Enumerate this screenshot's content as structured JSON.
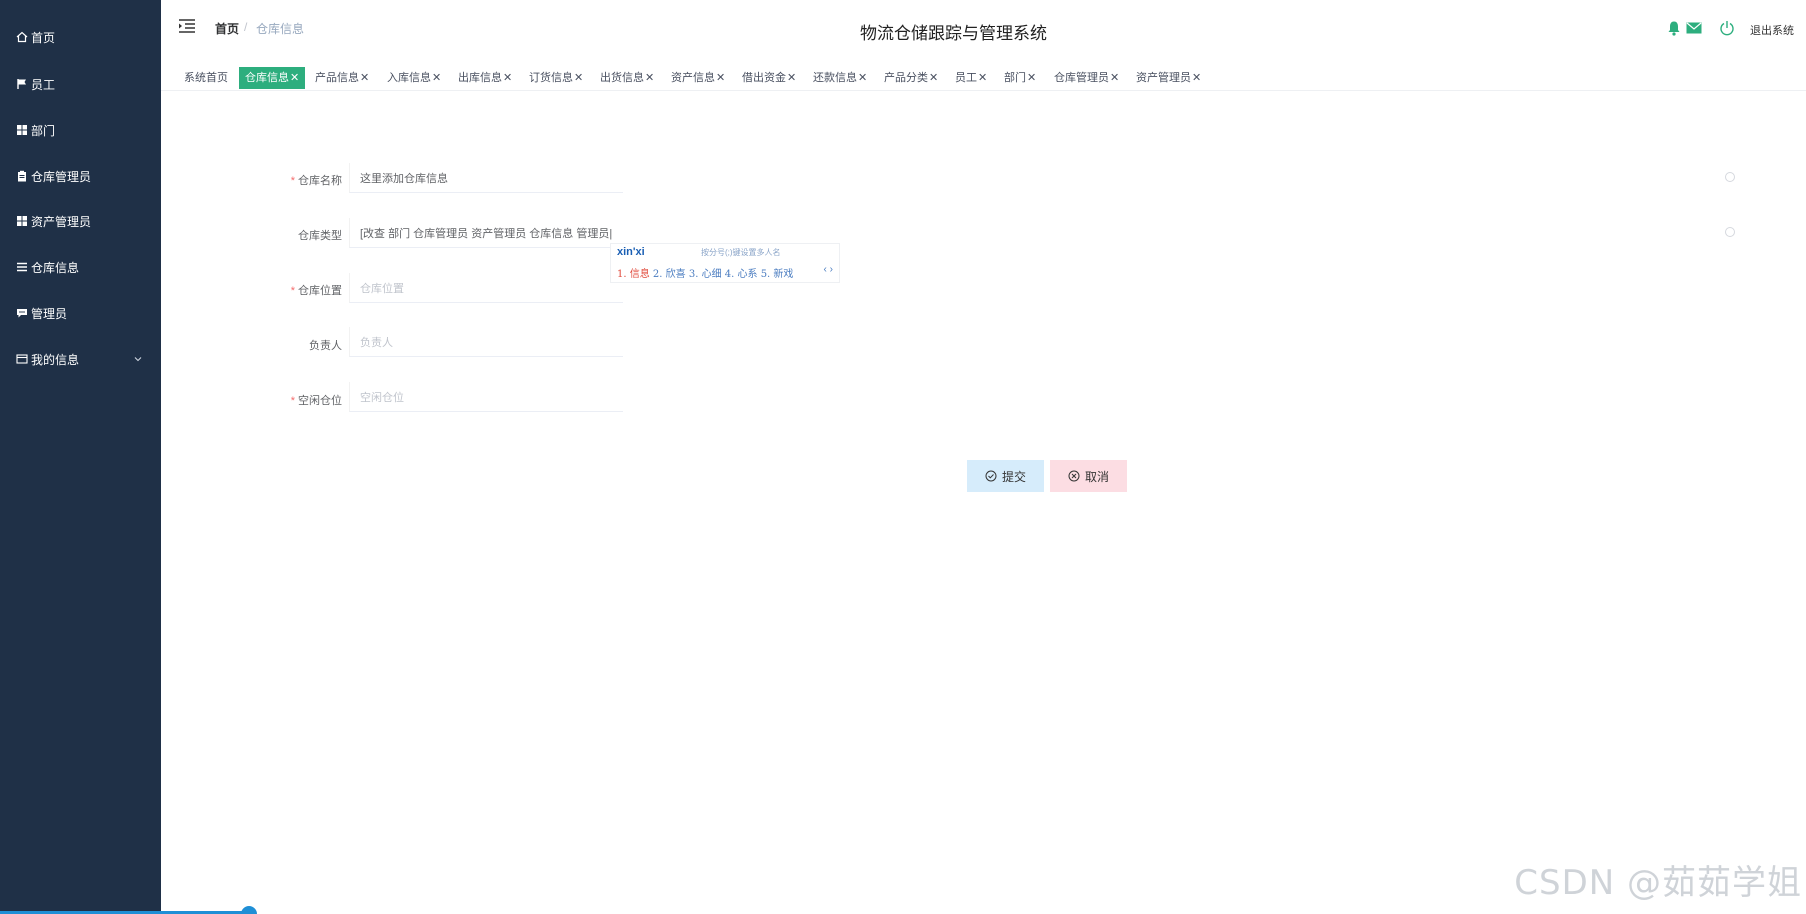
{
  "sidebar": {
    "items": [
      {
        "label": "首页",
        "icon": "home-icon"
      },
      {
        "label": "员工",
        "icon": "flag-icon"
      },
      {
        "label": "部门",
        "icon": "grid-icon"
      },
      {
        "label": "仓库管理员",
        "icon": "clipboard-icon"
      },
      {
        "label": "资产管理员",
        "icon": "grid-icon"
      },
      {
        "label": "仓库信息",
        "icon": "list-icon"
      },
      {
        "label": "管理员",
        "icon": "comment-icon"
      },
      {
        "label": "我的信息",
        "icon": "card-icon"
      }
    ]
  },
  "header": {
    "breadcrumb_home": "首页",
    "breadcrumb_sep": "/",
    "breadcrumb_current": "仓库信息",
    "title": "物流仓储跟踪与管理系统",
    "logout": "退出系统"
  },
  "tags": [
    {
      "label": "系统首页",
      "closable": false
    },
    {
      "label": "仓库信息",
      "closable": true,
      "active": true
    },
    {
      "label": "产品信息",
      "closable": true
    },
    {
      "label": "入库信息",
      "closable": true
    },
    {
      "label": "出库信息",
      "closable": true
    },
    {
      "label": "订货信息",
      "closable": true
    },
    {
      "label": "出货信息",
      "closable": true
    },
    {
      "label": "资产信息",
      "closable": true
    },
    {
      "label": "借出资金",
      "closable": true
    },
    {
      "label": "还款信息",
      "closable": true
    },
    {
      "label": "产品分类",
      "closable": true
    },
    {
      "label": "员工",
      "closable": true
    },
    {
      "label": "部门",
      "closable": true
    },
    {
      "label": "仓库管理员",
      "closable": true
    },
    {
      "label": "资产管理员",
      "closable": true
    }
  ],
  "form": {
    "fields": [
      {
        "label": "仓库名称",
        "required": true,
        "value": "这里添加仓库信息",
        "placeholder": ""
      },
      {
        "label": "仓库类型",
        "required": false,
        "value": "[改查 部门 仓库管理员 资产管理员 仓库信息  管理员|",
        "placeholder": ""
      },
      {
        "label": "仓库位置",
        "required": true,
        "value": "",
        "placeholder": "仓库位置"
      },
      {
        "label": "负责人",
        "required": false,
        "value": "",
        "placeholder": "负责人"
      },
      {
        "label": "空闲仓位",
        "required": true,
        "value": "",
        "placeholder": "空闲仓位"
      }
    ],
    "submit": "提交",
    "cancel": "取消"
  },
  "ime": {
    "pinyin": "xin'xi",
    "hint": "按分号(;)键设置多人名",
    "candidates": [
      "1. 信息",
      "2. 欣喜",
      "3. 心细",
      "4. 心系",
      "5. 新戏"
    ],
    "nav": "‹ ›"
  },
  "watermark": "CSDN @茹茹学姐",
  "colors": {
    "sidebar": "#1f3047",
    "accent": "#2dae7e",
    "required": "#f56c6c"
  }
}
